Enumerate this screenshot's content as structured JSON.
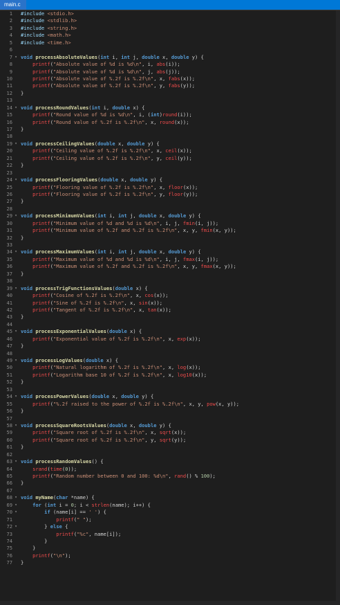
{
  "tab": {
    "label": "main.c"
  },
  "line_numbers": [
    "1",
    "2",
    "3",
    "4",
    "5",
    "6",
    "7",
    "8",
    "9",
    "10",
    "11",
    "12",
    "13",
    "14",
    "15",
    "16",
    "17",
    "18",
    "19",
    "20",
    "21",
    "22",
    "23",
    "24",
    "25",
    "26",
    "27",
    "28",
    "29",
    "30",
    "31",
    "32",
    "33",
    "34",
    "35",
    "36",
    "37",
    "38",
    "39",
    "40",
    "41",
    "42",
    "43",
    "44",
    "45",
    "46",
    "47",
    "48",
    "49",
    "50",
    "51",
    "52",
    "53",
    "54",
    "55",
    "56",
    "57",
    "58",
    "59",
    "60",
    "61",
    "62",
    "63",
    "64",
    "65",
    "66",
    "67",
    "68",
    "69",
    "70",
    "71",
    "72",
    "73",
    "74",
    "75",
    "76",
    "77"
  ],
  "lines": [
    "#include <stdio.h>",
    "#include <stdlib.h>",
    "#include <string.h>",
    "#include <math.h>",
    "#include <time.h>",
    "",
    "void processAbsoluteValues(int i, int j, double x, double y) {",
    "    printf(\"Absolute value of %d is %d\\n\", i, abs(i));",
    "    printf(\"Absolute value of %d is %d\\n\", j, abs(j));",
    "    printf(\"Absolute value of %.2f is %.2f\\n\", x, fabs(x));",
    "    printf(\"Absolute value of %.2f is %.2f\\n\", y, fabs(y));",
    "}",
    "",
    "void processRoundValues(int i, double x) {",
    "    printf(\"Round value of %d is %d\\n\", i, (int)round(i));",
    "    printf(\"Round value of %.2f is %.2f\\n\", x, round(x));",
    "}",
    "",
    "void processCeilingValues(double x, double y) {",
    "    printf(\"Ceiling value of %.2f is %.2f\\n\", x, ceil(x));",
    "    printf(\"Ceiling value of %.2f is %.2f\\n\", y, ceil(y));",
    "}",
    "",
    "void processFlooringValues(double x, double y) {",
    "    printf(\"Flooring value of %.2f is %.2f\\n\", x, floor(x));",
    "    printf(\"Flooring value of %.2f is %.2f\\n\", y, floor(y));",
    "}",
    "",
    "void processMinimumValues(int i, int j, double x, double y) {",
    "    printf(\"Minimum value of %d and %d is %d\\n\", i, j, fmin(i, j));",
    "    printf(\"Minimum value of %.2f and %.2f is %.2f\\n\", x, y, fmin(x, y));",
    "}",
    "",
    "void processMaximumValues(int i, int j, double x, double y) {",
    "    printf(\"Maximum value of %d and %d is %d\\n\", i, j, fmax(i, j));",
    "    printf(\"Maximum value of %.2f and %.2f is %.2f\\n\", x, y, fmax(x, y));",
    "}",
    "",
    "void processTrigFunctionsValues(double x) {",
    "    printf(\"Cosine of %.2f is %.2f\\n\", x, cos(x));",
    "    printf(\"Sine of %.2f is %.2f\\n\", x, sin(x));",
    "    printf(\"Tangent of %.2f is %.2f\\n\", x, tan(x));",
    "}",
    "",
    "void processExponentialValues(double x) {",
    "    printf(\"Exponential value of %.2f is %.2f\\n\", x, exp(x));",
    "}",
    "",
    "void processLogValues(double x) {",
    "    printf(\"Natural logarithm of %.2f is %.2f\\n\", x, log(x));",
    "    printf(\"Logarithm base 10 of %.2f is %.2f\\n\", x, log10(x));",
    "}",
    "",
    "void processPowerValues(double x, double y) {",
    "    printf(\"%.2f raised to the power of %.2f is %.2f\\n\", x, y, pow(x, y));",
    "}",
    "",
    "void processSquareRootsValues(double x, double y) {",
    "    printf(\"Square root of %.2f is %.2f\\n\", x, sqrt(x));",
    "    printf(\"Square root of %.2f is %.2f\\n\", y, sqrt(y));",
    "}",
    "",
    "void processRandomValues() {",
    "    srand(time(0));",
    "    printf(\"Random number between 0 and 100: %d\\n\", rand() % 100);",
    "}",
    "",
    "void myName(char *name) {",
    "    for (int i = 0; i < strlen(name); i++) {",
    "        if (name[i] == ' ') {",
    "            printf(\" \");",
    "        } else {",
    "            printf(\"%c\", name[i]);",
    "        }",
    "    }",
    "    printf(\"\\n\");",
    "}"
  ]
}
